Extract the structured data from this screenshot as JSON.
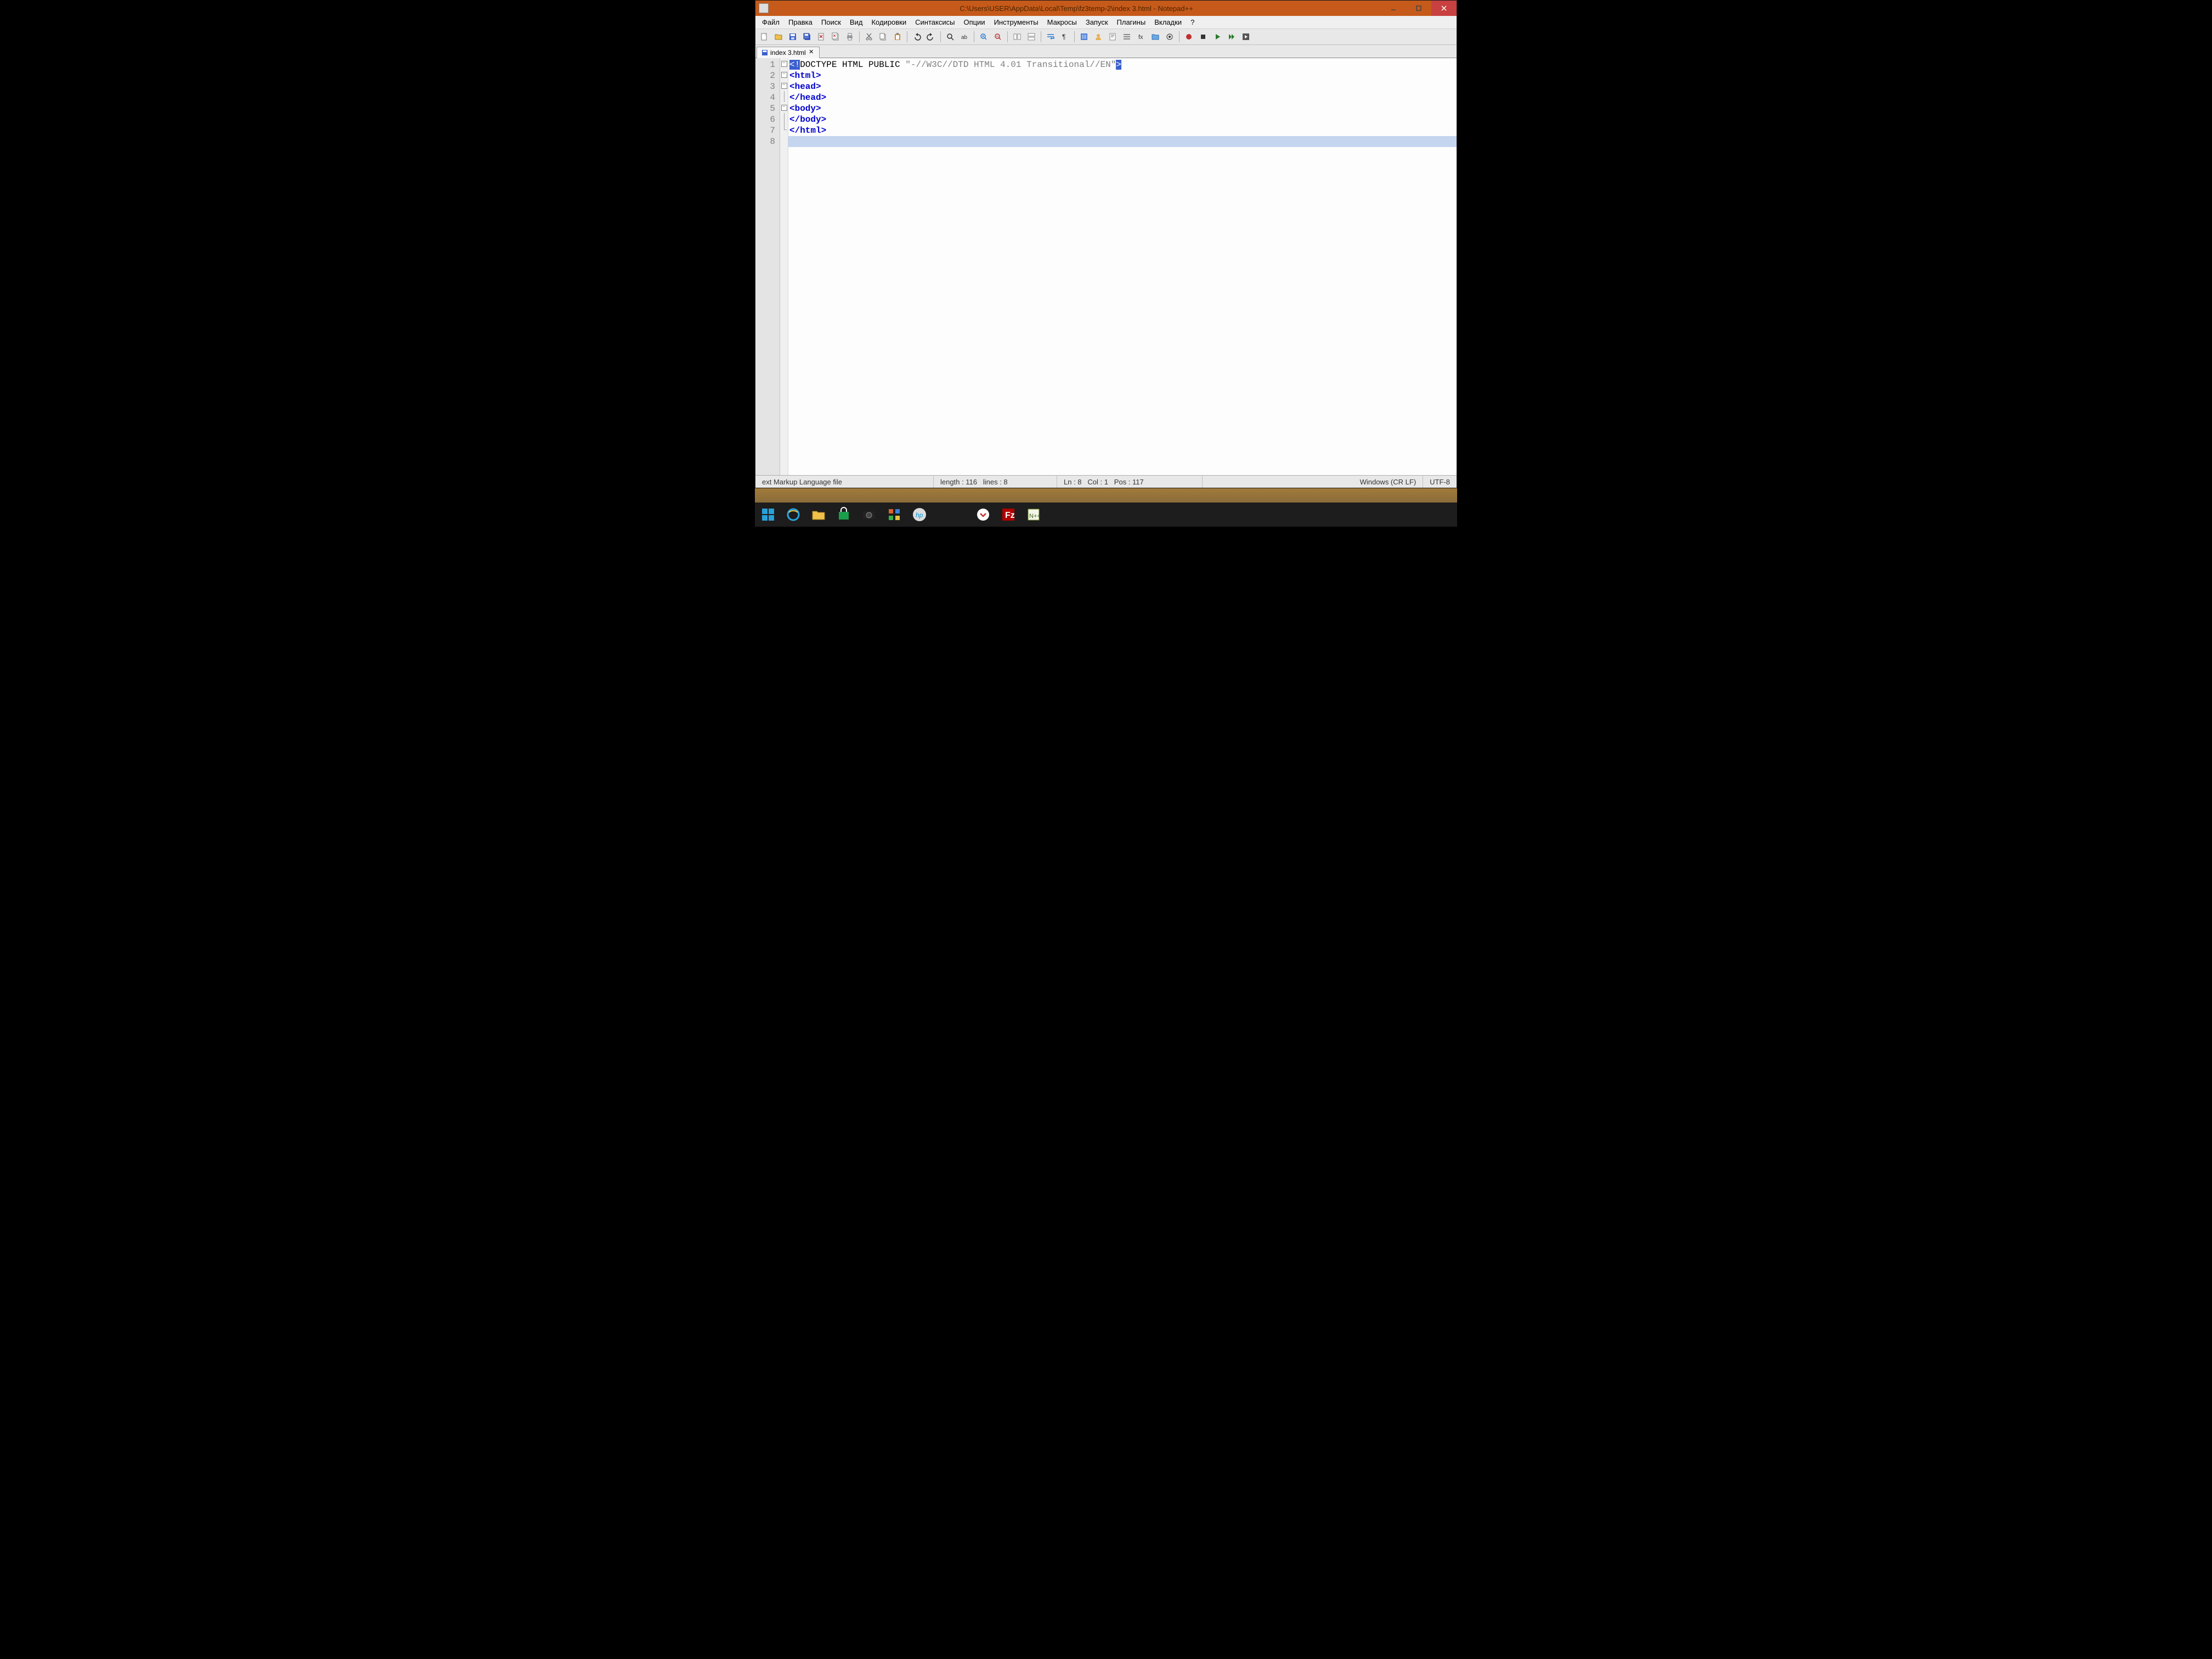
{
  "titlebar": {
    "title": "C:\\Users\\USER\\AppData\\Local\\Temp\\fz3temp-2\\index 3.html - Notepad++"
  },
  "menu": {
    "items": [
      "Файл",
      "Правка",
      "Поиск",
      "Вид",
      "Кодировки",
      "Синтаксисы",
      "Опции",
      "Инструменты",
      "Макросы",
      "Запуск",
      "Плагины",
      "Вкладки",
      "?"
    ]
  },
  "tabs": {
    "active": {
      "label": "index 3.html"
    }
  },
  "code": {
    "lines": [
      {
        "n": 1,
        "fold": "box",
        "segments": [
          {
            "cls": "doctype-sel",
            "t": "<!"
          },
          {
            "cls": "",
            "t": "DOCTYPE HTML PUBLIC "
          },
          {
            "cls": "str",
            "t": "\"-//W3C//DTD HTML 4.01 Transitional//EN\""
          },
          {
            "cls": "doctype-sel",
            "t": ">"
          }
        ]
      },
      {
        "n": 2,
        "fold": "box",
        "segments": [
          {
            "cls": "kw",
            "t": "<html>"
          }
        ]
      },
      {
        "n": 3,
        "fold": "box",
        "segments": [
          {
            "cls": "kw",
            "t": "<head>"
          }
        ]
      },
      {
        "n": 4,
        "fold": "vline",
        "segments": [
          {
            "cls": "kw",
            "t": "</head>"
          }
        ]
      },
      {
        "n": 5,
        "fold": "box",
        "segments": [
          {
            "cls": "kw",
            "t": "<body>"
          }
        ]
      },
      {
        "n": 6,
        "fold": "vline",
        "segments": [
          {
            "cls": "kw",
            "t": "</body>"
          }
        ]
      },
      {
        "n": 7,
        "fold": "corner",
        "segments": [
          {
            "cls": "kw",
            "t": "</html>"
          }
        ]
      },
      {
        "n": 8,
        "fold": "",
        "current": true,
        "segments": [
          {
            "cls": "",
            "t": ""
          }
        ]
      }
    ]
  },
  "status": {
    "filetype": "ext Markup Language file",
    "length_label": "length : 116",
    "lines_label": "lines : 8",
    "ln_label": "Ln : 8",
    "col_label": "Col : 1",
    "pos_label": "Pos : 117",
    "eol": "Windows (CR LF)",
    "encoding": "UTF-8"
  }
}
